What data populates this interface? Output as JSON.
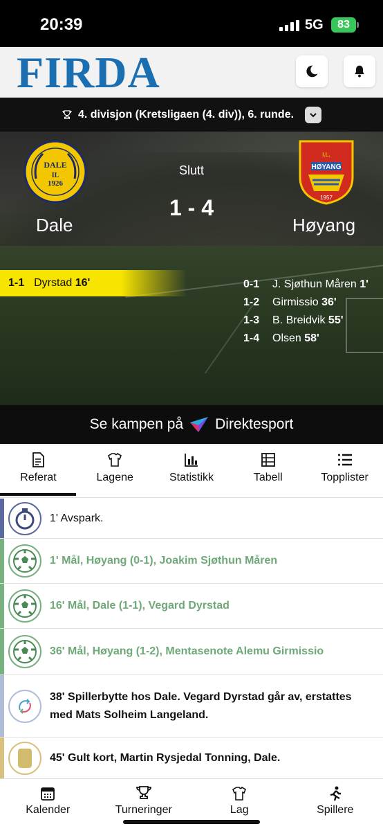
{
  "status_bar": {
    "time": "20:39",
    "network": "5G",
    "battery": "83"
  },
  "header": {
    "logo": "FIRDA"
  },
  "league": {
    "label": "4. divisjon (Kretsligaen (4. div)), 6. runde."
  },
  "match": {
    "status": "Slutt",
    "score": "1 - 4",
    "home": {
      "name": "Dale",
      "crest_text": "DALE IL 1926"
    },
    "away": {
      "name": "Høyang",
      "crest_text": "IL HØYANG 1957"
    },
    "home_goals": [
      {
        "score": "1-1",
        "player": "Dyrstad",
        "minute": "16'"
      }
    ],
    "away_goals": [
      {
        "score": "0-1",
        "player": "J. Sjøthun Måren",
        "minute": "1'"
      },
      {
        "score": "1-2",
        "player": "Girmissio",
        "minute": "36'"
      },
      {
        "score": "1-3",
        "player": "B. Breidvik",
        "minute": "55'"
      },
      {
        "score": "1-4",
        "player": "Olsen",
        "minute": "58'"
      }
    ]
  },
  "stream": {
    "prefix": "Se kampen på",
    "provider": "Direktesport"
  },
  "tabs": [
    {
      "label": "Referat",
      "icon": "document-icon"
    },
    {
      "label": "Lagene",
      "icon": "jersey-icon"
    },
    {
      "label": "Statistikk",
      "icon": "chart-icon"
    },
    {
      "label": "Tabell",
      "icon": "table-icon"
    },
    {
      "label": "Topplister",
      "icon": "list-icon"
    }
  ],
  "events": [
    {
      "type": "kickoff",
      "text": "1' Avspark."
    },
    {
      "type": "goal",
      "text": "1' Mål, Høyang (0-1), Joakim Sjøthun Måren"
    },
    {
      "type": "goal",
      "text": "16' Mål, Dale (1-1), Vegard Dyrstad"
    },
    {
      "type": "goal",
      "text": "36' Mål, Høyang (1-2), Mentasenote Alemu Girmissio"
    },
    {
      "type": "sub",
      "text": "38' Spillerbytte hos Dale. Vegard Dyrstad går av, erstattes med Mats Solheim Langeland."
    },
    {
      "type": "yellow",
      "text": "45' Gult kort, Martin Rysjedal Tonning, Dale."
    }
  ],
  "colors": {
    "logo": "#1b6fb1",
    "highlight": "#f7e400",
    "goal_text": "#6fa978",
    "battery": "#37c659"
  },
  "bottom_nav": [
    {
      "label": "Kalender",
      "icon": "calendar-icon"
    },
    {
      "label": "Turneringer",
      "icon": "trophy-icon"
    },
    {
      "label": "Lag",
      "icon": "jersey-icon"
    },
    {
      "label": "Spillere",
      "icon": "runner-icon"
    }
  ]
}
